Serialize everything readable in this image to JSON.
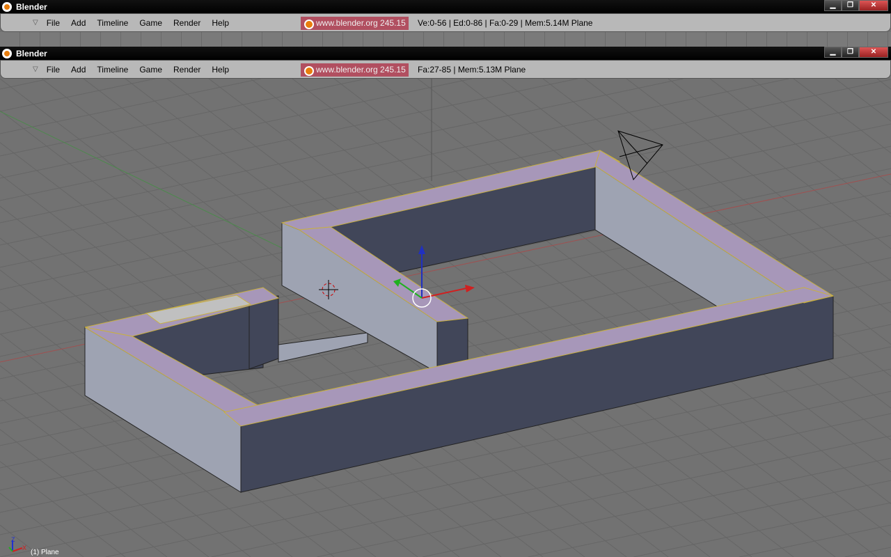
{
  "windows": [
    {
      "title": "Blender",
      "menu": [
        "File",
        "Add",
        "Timeline",
        "Game",
        "Render",
        "Help"
      ],
      "badge": "www.blender.org 245.15",
      "stats": "Ve:0-56 | Ed:0-86 | Fa:0-29 | Mem:5.14M Plane"
    },
    {
      "title": "Blender",
      "menu": [
        "File",
        "Add",
        "Timeline",
        "Game",
        "Render",
        "Help"
      ],
      "badge": "www.blender.org 245.15",
      "stats": "Fa:27-85 | Mem:5.13M Plane"
    }
  ],
  "viewport": {
    "object_label": "(1) Plane",
    "axis_labels": {
      "x": "X",
      "z": "Z"
    }
  },
  "colors": {
    "top_face": "#a797b9",
    "light_side": "#9ea3b2",
    "dark_side": "#414659",
    "grid": "#727272"
  }
}
